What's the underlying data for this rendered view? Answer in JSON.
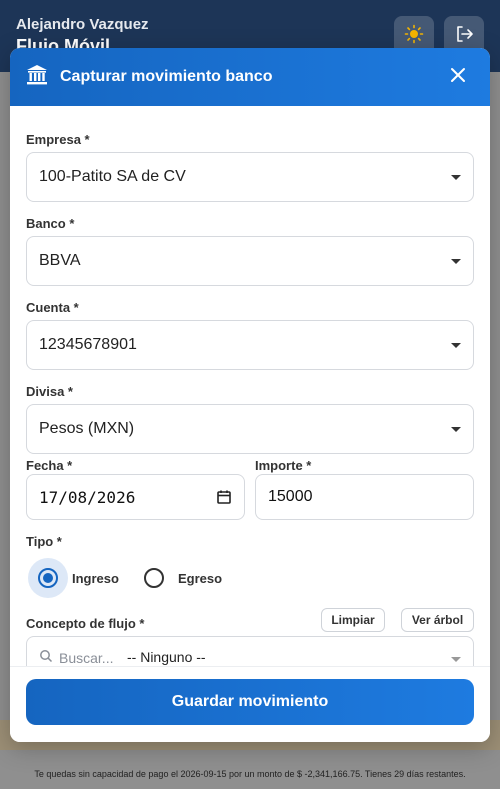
{
  "app": {
    "user_name": "Alejandro Vazquez",
    "title": "Flujo Móvil"
  },
  "modal": {
    "title": "Capturar movimiento banco",
    "fields": {
      "empresa": {
        "label": "Empresa *",
        "value": "100-Patito SA de CV"
      },
      "banco": {
        "label": "Banco *",
        "value": "BBVA"
      },
      "cuenta": {
        "label": "Cuenta *",
        "value": "12345678901"
      },
      "divisa": {
        "label": "Divisa *",
        "value": "Pesos (MXN)"
      },
      "fecha": {
        "label": "Fecha *",
        "value": "17/08/2026"
      },
      "importe": {
        "label": "Importe *",
        "value": "15000"
      },
      "tipo": {
        "label": "Tipo *",
        "options": [
          "Ingreso",
          "Egreso"
        ],
        "selected": "Ingreso"
      },
      "concepto": {
        "label": "Concepto de flujo *",
        "clear_label": "Limpiar",
        "tree_label": "Ver árbol",
        "search_placeholder": "Buscar...",
        "value": "-- Ninguno --"
      }
    },
    "save_label": "Guardar movimiento"
  },
  "footer_note": "Te quedas sin capacidad de pago el 2026-09-15 por un monto de $ -2,341,166.75. Tienes 29 días restantes.",
  "colors": {
    "primary": "#1565c0",
    "header_bg": "#1d3557"
  },
  "icons": {
    "theme": "sun-icon",
    "logout": "logout-icon",
    "modal": "bank-icon",
    "close": "close-icon",
    "calendar": "calendar-icon",
    "search": "search-icon"
  }
}
